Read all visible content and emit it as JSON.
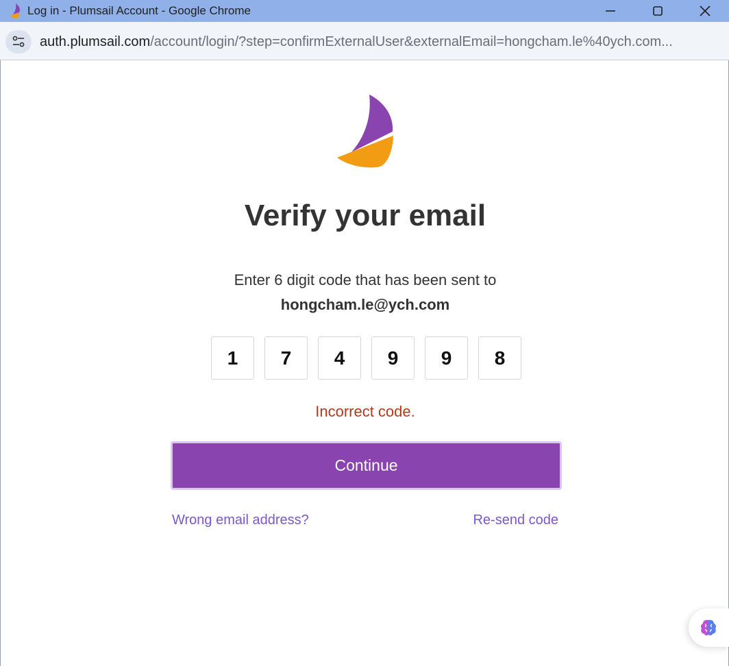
{
  "window": {
    "title": "Log in - Plumsail Account - Google Chrome"
  },
  "address_bar": {
    "host": "auth.plumsail.com",
    "path": "/account/login/?step=confirmExternalUser&externalEmail=hongcham.le%40ych.com..."
  },
  "page": {
    "heading": "Verify your email",
    "instruction": "Enter 6 digit code that has been sent to",
    "email": "hongcham.le@ych.com",
    "code_digits": [
      "1",
      "7",
      "4",
      "9",
      "9",
      "8"
    ],
    "error": "Incorrect code.",
    "continue_label": "Continue",
    "wrong_email_link": "Wrong email address?",
    "resend_link": "Re-send code"
  },
  "colors": {
    "brand_purple": "#8a44b0",
    "brand_orange": "#f29c14",
    "error_red": "#b33a1a",
    "link_purple": "#7b57c9",
    "titlebar_blue": "#8fb0e8"
  },
  "icons": {
    "app": "plumsail-sail-icon",
    "site_info": "tune-icon",
    "minimize": "minimize-icon",
    "maximize": "maximize-icon",
    "close": "close-icon",
    "assistant": "brain-icon"
  }
}
